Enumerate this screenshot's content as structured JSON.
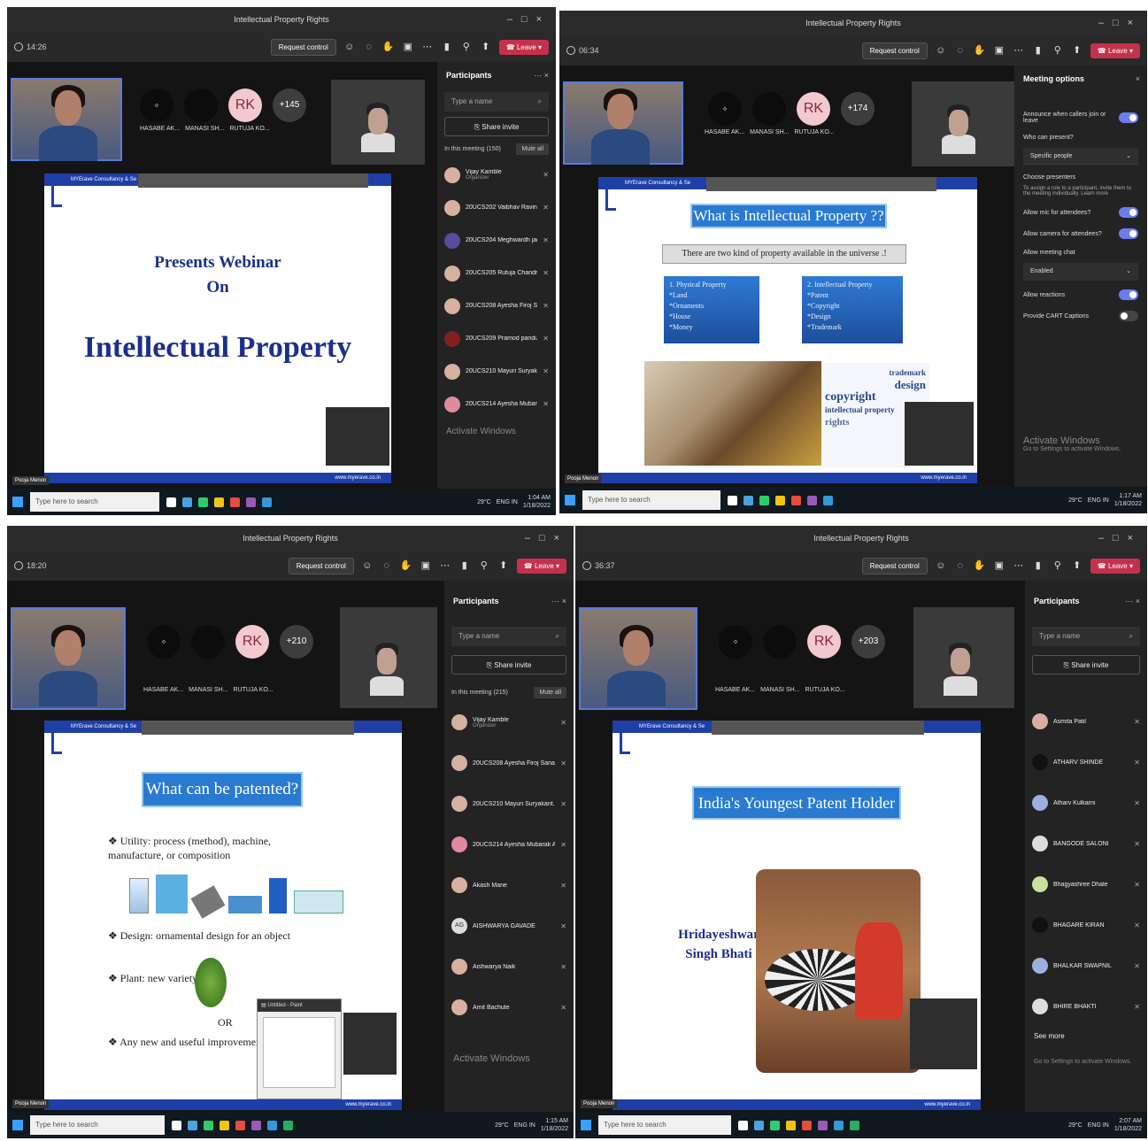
{
  "common": {
    "window_title": "Intellectual Property Rights",
    "request_control": "Request control",
    "leave": "Leave",
    "taskbar_search": "Type here to search",
    "participants_title": "Participants",
    "search_placeholder": "Type a name",
    "share_invite": "Share invite",
    "mute_all": "Mute all",
    "presenter_name": "Pooja Menon",
    "website": "www.myerave.co.in",
    "header_text": "MYErave Consultancy & Se",
    "avatar_rk": "RK",
    "avatar_names": [
      "HASABE AK...",
      "MANASI SH...",
      "RUTUJA KO..."
    ],
    "weather": "29°C",
    "lang": "ENG IN",
    "activate_windows": "Activate Windows",
    "activate_sub": "Go to Settings to activate Windows.",
    "date": "1/18/2022"
  },
  "p1": {
    "timer": "14:26",
    "more_count": "+145",
    "in_meeting": "In this meeting (150)",
    "slide": {
      "line1": "Presents Webinar",
      "line2": "On",
      "line3": "Intellectual Property"
    },
    "participants": [
      {
        "name": "Vijay Kamble",
        "role": "Organizer"
      },
      {
        "name": "20UCS202 Vaibhav Ravindra..."
      },
      {
        "name": "20UCS204 Meghwardh jagann..."
      },
      {
        "name": "20UCS205 Rutuja Chandrakan..."
      },
      {
        "name": "20UCS208 Ayesha Firoj Sanadi"
      },
      {
        "name": "20UCS209 Pramod pandurang..."
      },
      {
        "name": "20UCS210 Mayuri Suryakant..."
      },
      {
        "name": "20UCS214 Ayesha Mubarak A..."
      }
    ],
    "time": "1:04 AM"
  },
  "p2": {
    "timer": "06:34",
    "more_count": "+174",
    "options_title": "Meeting options",
    "options": {
      "announce": "Announce when callers join or leave",
      "who_present": "Who can present?",
      "who_present_value": "Specific people",
      "choose": "Choose presenters",
      "choose_help": "To assign a role to a participant, invite them to the meeting individually. Learn more",
      "mic": "Allow mic for attendees?",
      "camera": "Allow camera for attendees?",
      "chat": "Allow meeting chat",
      "chat_value": "Enabled",
      "reactions": "Allow reactions",
      "cart": "Provide CART Captions"
    },
    "slide": {
      "title": "What is Intellectual Property ??",
      "subtitle": "There are two kind of property available in the universe .!",
      "box1": [
        "1. Physical Property",
        "*Land",
        "*Ornaments",
        "*House",
        "*Money"
      ],
      "box2": [
        "2. Intellectual Property",
        "*Patent",
        "*Copyright",
        "*Design",
        "*Trademark"
      ],
      "cloud": [
        "trademark",
        "design",
        "copyright",
        "intellectual property",
        "rights"
      ]
    },
    "time": "1:17 AM"
  },
  "p3": {
    "timer": "18:20",
    "more_count": "+210",
    "in_meeting": "In this meeting (215)",
    "slide": {
      "title": "What can be patented?",
      "b1": "Utility: process (method), machine, manufacture, or composition",
      "b2": "Design: ornamental design for an object",
      "b3": "Plant: new variety",
      "or": "OR",
      "b4": "Any new and useful improvement",
      "paint": "Untitled - Paint"
    },
    "participants": [
      {
        "name": "Vijay Kamble",
        "role": "Organizer"
      },
      {
        "name": "20UCS208 Ayesha Firoj Sanadi"
      },
      {
        "name": "20UCS210 Mayuri Suryakant..."
      },
      {
        "name": "20UCS214 Ayesha Mubarak A..."
      },
      {
        "name": "Akash Mane"
      },
      {
        "name": "AISHWARYA GAVADE",
        "initials": "AG"
      },
      {
        "name": "Aishwarya Naik"
      },
      {
        "name": "Amit Bachute"
      }
    ],
    "time": "1:15 AM"
  },
  "p4": {
    "timer": "36:37",
    "more_count": "+203",
    "slide": {
      "title": "India's Youngest Patent Holder",
      "name1": "Hridayeshwar",
      "name2": "Singh Bhati"
    },
    "participants": [
      {
        "name": "Asmita Patil"
      },
      {
        "name": "ATHARV SHINDE"
      },
      {
        "name": "Atharv Kulkarni"
      },
      {
        "name": "BANGODE SALONI"
      },
      {
        "name": "Bhagyashree Dhale"
      },
      {
        "name": "BHAGARE KIRAN"
      },
      {
        "name": "BHALKAR SWAPNIL"
      },
      {
        "name": "BHIRE BHAKTI"
      }
    ],
    "see_more": "See more",
    "time": "2:07 AM"
  }
}
